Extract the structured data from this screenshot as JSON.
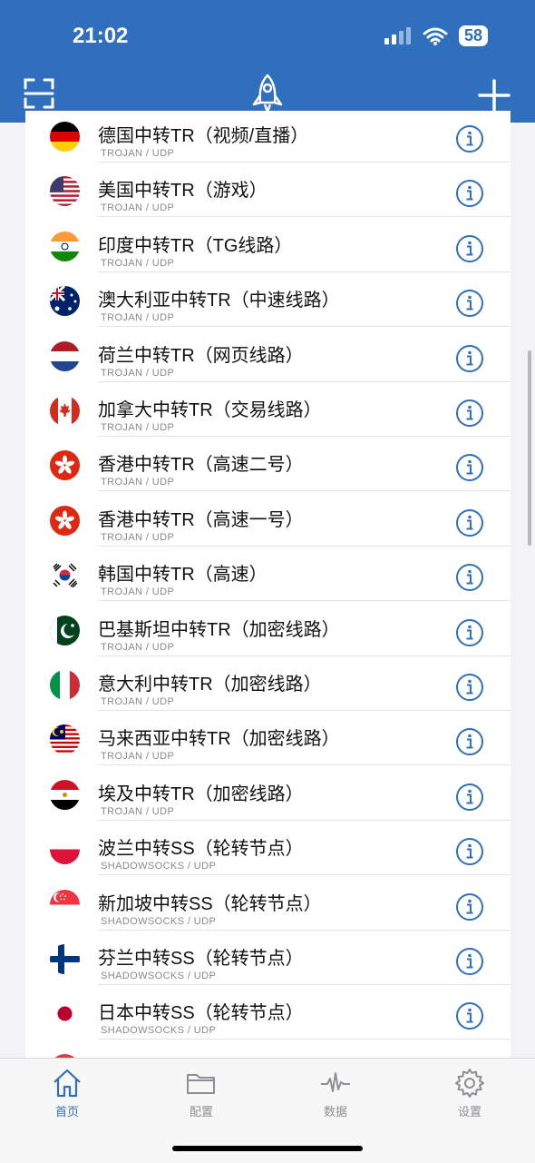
{
  "status_bar": {
    "time": "21:02",
    "battery": "58"
  },
  "header": {
    "scan_icon": "scan-icon",
    "rocket_icon": "rocket-icon",
    "add_icon": "plus-icon"
  },
  "servers": [
    {
      "name": "德国中转TR（视频/直播）",
      "protocol": "TROJAN / UDP",
      "flag": "de"
    },
    {
      "name": "美国中转TR（游戏）",
      "protocol": "TROJAN / UDP",
      "flag": "us"
    },
    {
      "name": "印度中转TR（TG线路）",
      "protocol": "TROJAN / UDP",
      "flag": "in"
    },
    {
      "name": "澳大利亚中转TR（中速线路）",
      "protocol": "TROJAN / UDP",
      "flag": "au"
    },
    {
      "name": "荷兰中转TR（网页线路）",
      "protocol": "TROJAN / UDP",
      "flag": "nl"
    },
    {
      "name": "加拿大中转TR（交易线路）",
      "protocol": "TROJAN / UDP",
      "flag": "ca"
    },
    {
      "name": "香港中转TR（高速二号）",
      "protocol": "TROJAN / UDP",
      "flag": "hk"
    },
    {
      "name": "香港中转TR（高速一号）",
      "protocol": "TROJAN / UDP",
      "flag": "hk"
    },
    {
      "name": "韩国中转TR（高速）",
      "protocol": "TROJAN / UDP",
      "flag": "kr"
    },
    {
      "name": "巴基斯坦中转TR（加密线路）",
      "protocol": "TROJAN / UDP",
      "flag": "pk"
    },
    {
      "name": "意大利中转TR（加密线路）",
      "protocol": "TROJAN / UDP",
      "flag": "it"
    },
    {
      "name": "马来西亚中转TR（加密线路）",
      "protocol": "TROJAN / UDP",
      "flag": "my"
    },
    {
      "name": "埃及中转TR（加密线路）",
      "protocol": "TROJAN / UDP",
      "flag": "eg"
    },
    {
      "name": "波兰中转SS（轮转节点）",
      "protocol": "SHADOWSOCKS / UDP",
      "flag": "pl"
    },
    {
      "name": "新加坡中转SS（轮转节点）",
      "protocol": "SHADOWSOCKS / UDP",
      "flag": "sg"
    },
    {
      "name": "芬兰中转SS（轮转节点）",
      "protocol": "SHADOWSOCKS / UDP",
      "flag": "fi"
    },
    {
      "name": "日本中转SS（轮转节点）",
      "protocol": "SHADOWSOCKS / UDP",
      "flag": "jp"
    }
  ],
  "tabs": [
    {
      "label": "首页",
      "icon": "home-icon",
      "active": true
    },
    {
      "label": "配置",
      "icon": "folder-icon",
      "active": false
    },
    {
      "label": "数据",
      "icon": "activity-icon",
      "active": false
    },
    {
      "label": "设置",
      "icon": "gear-icon",
      "active": false
    }
  ],
  "colors": {
    "accent": "#2f6fbd",
    "inactive": "#8e8e93"
  }
}
